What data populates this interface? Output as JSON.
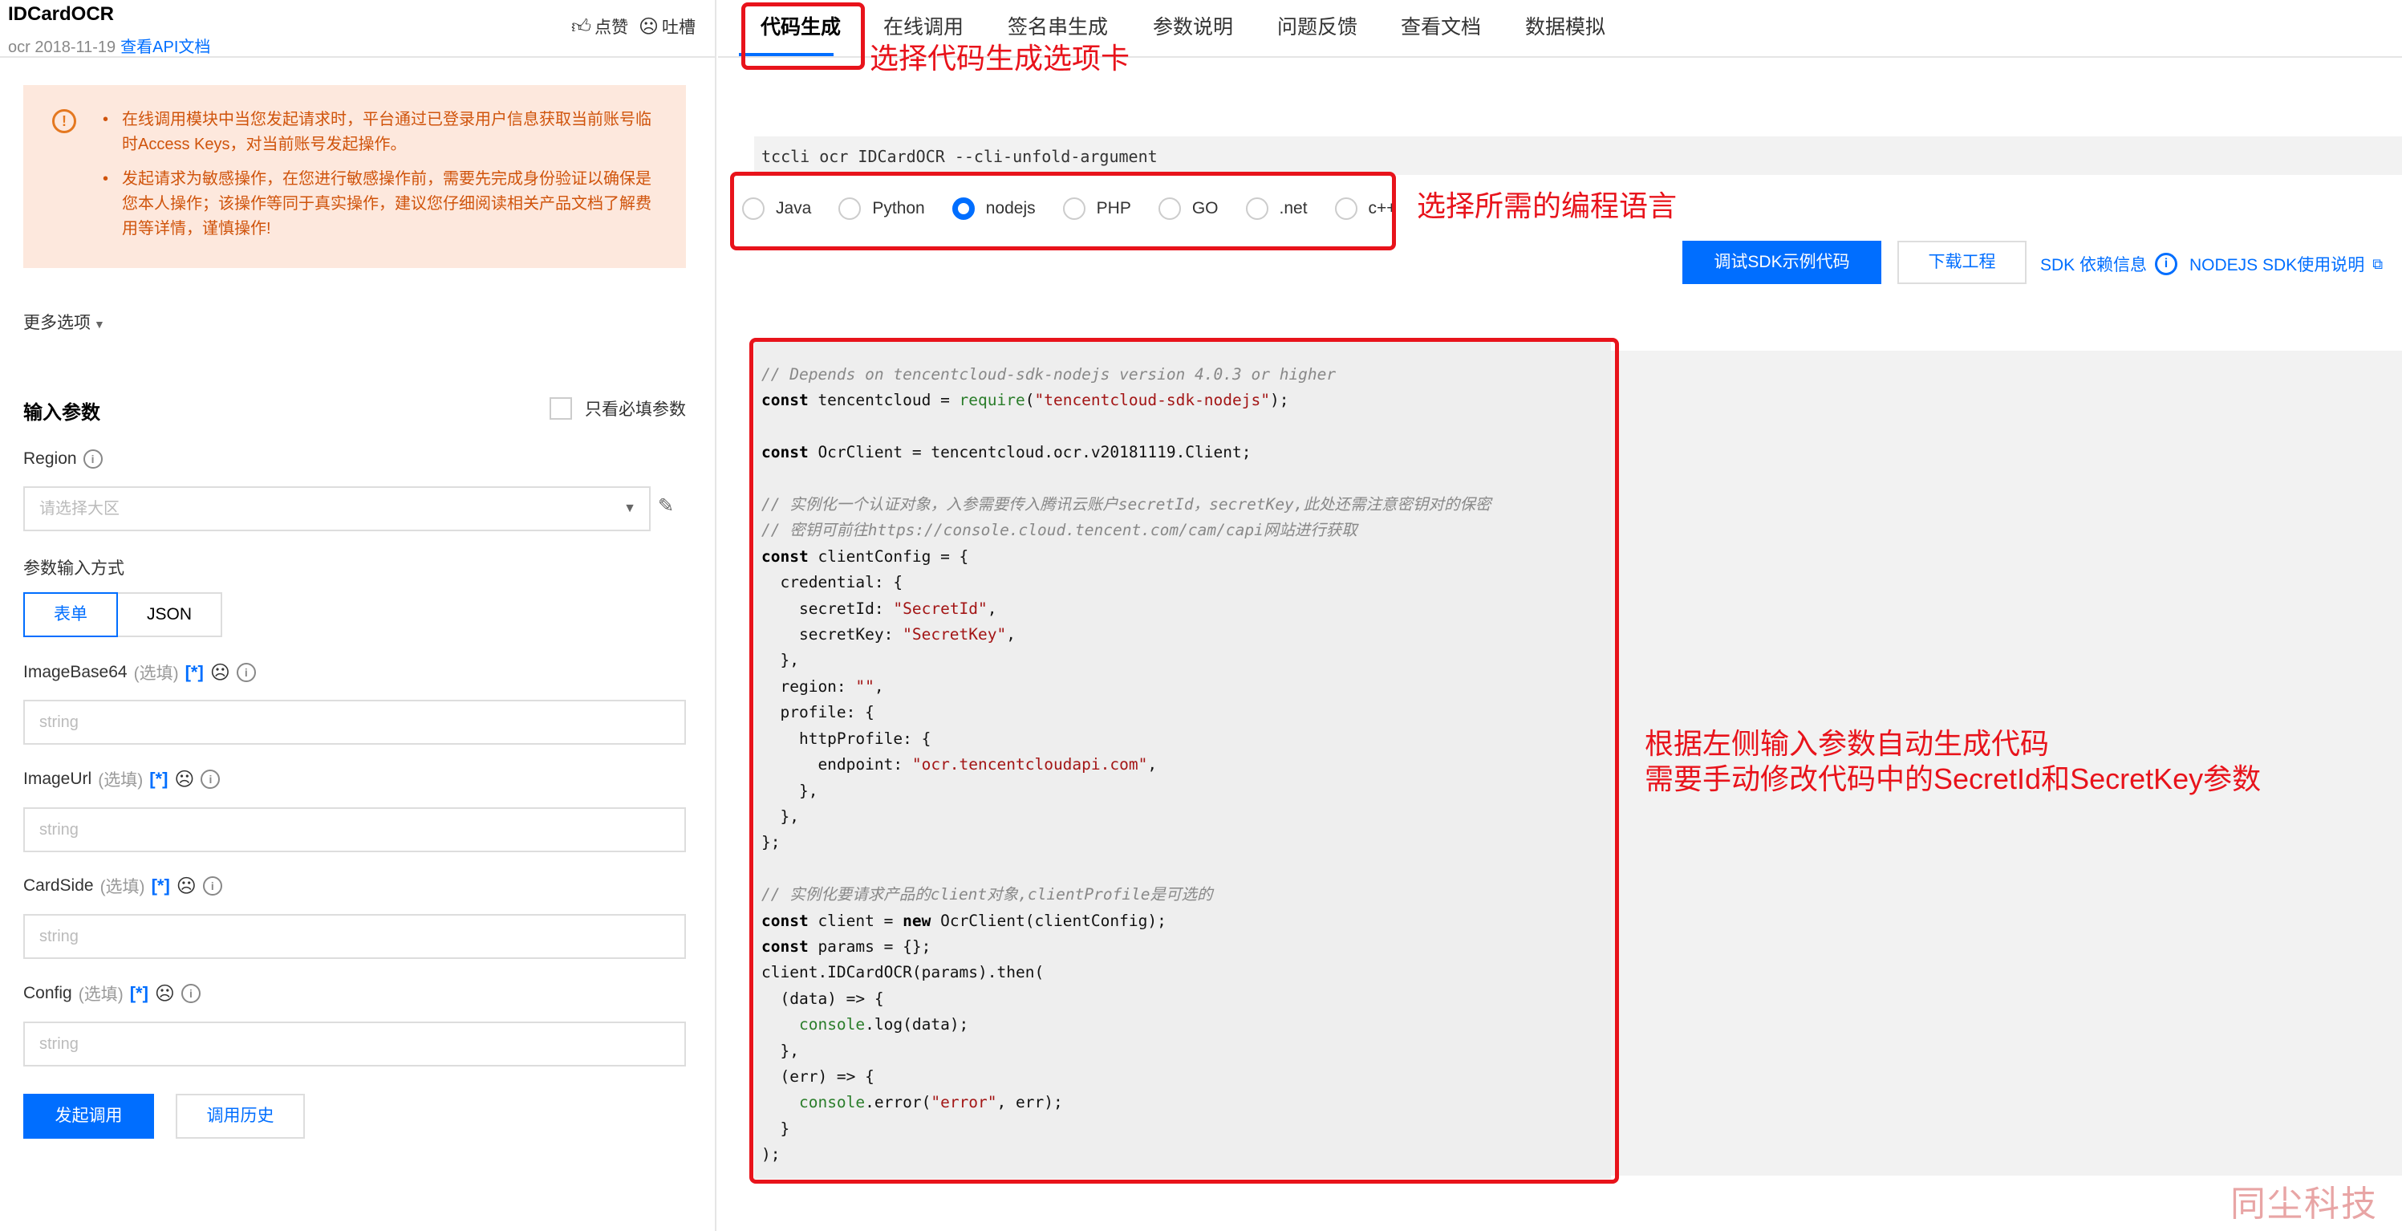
{
  "header": {
    "title": "IDCardOCR",
    "sub_prefix": "ocr 2018-11-19",
    "api_doc_link": "查看API文档",
    "like_label": "点赞",
    "complain_label": "吐槽"
  },
  "warning": {
    "items": [
      "在线调用模块中当您发起请求时，平台通过已登录用户信息获取当前账号临时Access Keys，对当前账号发起操作。",
      "发起请求为敏感操作，在您进行敏感操作前，需要先完成身份验证以确保是您本人操作；该操作等同于真实操作，建议您仔细阅读相关产品文档了解费用等详情，谨慎操作!"
    ]
  },
  "more_options": "更多选项",
  "input_params": {
    "title": "输入参数",
    "only_required": "只看必填参数"
  },
  "region": {
    "label": "Region",
    "placeholder": "请选择大区"
  },
  "input_mode": {
    "label": "参数输入方式",
    "form": "表单",
    "json": "JSON"
  },
  "params": [
    {
      "name": "ImageBase64",
      "optional": "(选填)",
      "placeholder": "string"
    },
    {
      "name": "ImageUrl",
      "optional": "(选填)",
      "placeholder": "string"
    },
    {
      "name": "CardSide",
      "optional": "(选填)",
      "placeholder": "string"
    },
    {
      "name": "Config",
      "optional": "(选填)",
      "placeholder": "string"
    }
  ],
  "icons": {
    "star": "[*]",
    "info": "i"
  },
  "actions": {
    "invoke": "发起调用",
    "history": "调用历史"
  },
  "tabs": [
    "代码生成",
    "在线调用",
    "签名串生成",
    "参数说明",
    "问题反馈",
    "查看文档",
    "数据模拟"
  ],
  "command": "tccli ocr IDCardOCR --cli-unfold-argument",
  "languages": [
    "Java",
    "Python",
    "nodejs",
    "PHP",
    "GO",
    ".net",
    "c++"
  ],
  "selected_language": "nodejs",
  "sdk_buttons": {
    "debug": "调试SDK示例代码",
    "download": "下载工程",
    "deps": "SDK 依赖信息",
    "usage": "NODEJS SDK使用说明"
  },
  "annotations": {
    "tab_note": "选择代码生成选项卡",
    "lang_note": "选择所需的编程语言",
    "code_note_1": "根据左侧输入参数自动生成代码",
    "code_note_2": "需要手动修改代码中的SecretId和SecretKey参数"
  },
  "watermark": "同尘科技",
  "colors": {
    "accent": "#006eff",
    "warning_bg": "#fde8dd",
    "warning_text": "#d0540c",
    "annotation_red": "#e8131b"
  }
}
